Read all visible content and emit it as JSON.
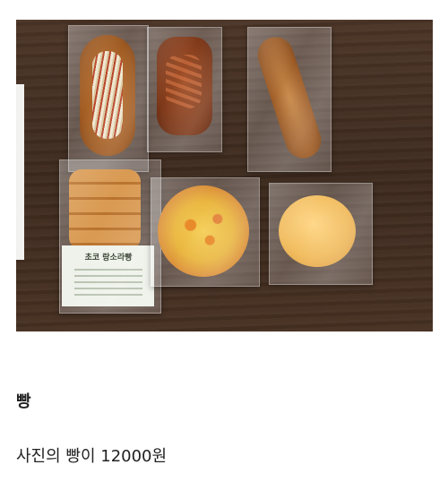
{
  "post": {
    "title": "빵",
    "body": "사진의 빵이 12000원"
  },
  "photo": {
    "description_label": "",
    "product_label": {
      "name": "초코 랑소라빵",
      "subtitle": "빵만소"
    }
  }
}
